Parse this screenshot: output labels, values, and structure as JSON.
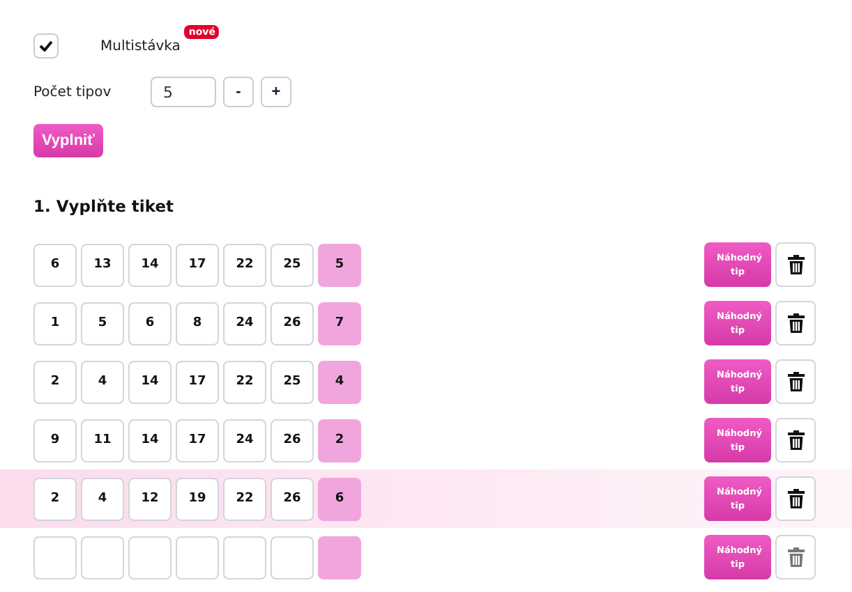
{
  "multibet": {
    "label": "Multistávka",
    "checked": true,
    "badge": "nové"
  },
  "tip_count": {
    "label": "Počet tipov",
    "value": "5",
    "minus": "-",
    "plus": "+"
  },
  "fill_button": "Vyplniť",
  "section_title": "1. Vyplňte tiket",
  "rows": [
    {
      "numbers": [
        "6",
        "13",
        "14",
        "17",
        "22",
        "25"
      ],
      "bonus": "5",
      "selected": false,
      "delete_disabled": false,
      "random_button": "Náhodný tip"
    },
    {
      "numbers": [
        "1",
        "5",
        "6",
        "8",
        "24",
        "26"
      ],
      "bonus": "7",
      "selected": false,
      "delete_disabled": false,
      "random_button": "Náhodný tip"
    },
    {
      "numbers": [
        "2",
        "4",
        "14",
        "17",
        "22",
        "25"
      ],
      "bonus": "4",
      "selected": false,
      "delete_disabled": false,
      "random_button": "Náhodný tip"
    },
    {
      "numbers": [
        "9",
        "11",
        "14",
        "17",
        "24",
        "26"
      ],
      "bonus": "2",
      "selected": false,
      "delete_disabled": false,
      "random_button": "Náhodný tip"
    },
    {
      "numbers": [
        "2",
        "4",
        "12",
        "19",
        "22",
        "26"
      ],
      "bonus": "6",
      "selected": true,
      "delete_disabled": false,
      "random_button": "Náhodný tip"
    },
    {
      "numbers": [],
      "selected": false,
      "delete_disabled": true,
      "random_button": "Náhodný tip"
    }
  ]
}
